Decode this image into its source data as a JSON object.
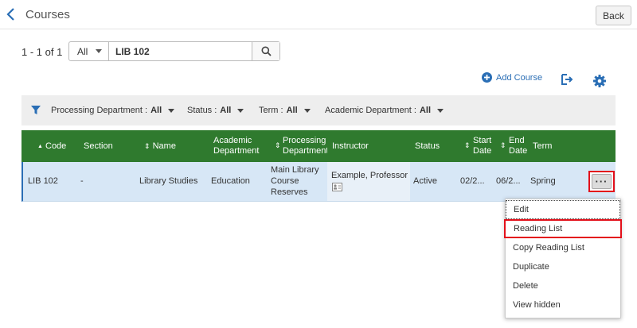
{
  "header": {
    "title": "Courses",
    "back_label": "Back"
  },
  "search": {
    "results_count": "1 - 1 of 1",
    "scope": "All",
    "query": "LIB 102"
  },
  "actions": {
    "add_course_label": "Add Course"
  },
  "filters": [
    {
      "label": "Processing Department :",
      "value": "All"
    },
    {
      "label": "Status :",
      "value": "All"
    },
    {
      "label": "Term :",
      "value": "All"
    },
    {
      "label": "Academic Department :",
      "value": "All"
    }
  ],
  "table": {
    "columns": [
      "Code",
      "Section",
      "Name",
      "Academic Department",
      "Processing Department",
      "Instructor",
      "Status",
      "Start Date",
      "End Date",
      "Term"
    ],
    "rows": [
      {
        "code": "LIB 102",
        "section": "-",
        "name": "Library Studies",
        "academic_department": "Education",
        "processing_department": "Main Library Course Reserves",
        "instructor": "Example, Professor",
        "status": "Active",
        "start_date": "02/2...",
        "end_date": "06/2...",
        "term": "Spring"
      }
    ]
  },
  "row_menu": [
    "Edit",
    "Reading List",
    "Copy Reading List",
    "Duplicate",
    "Delete",
    "View hidden"
  ],
  "colors": {
    "header_green": "#2f7a2e",
    "row_selected": "#d7e7f6",
    "highlight_red": "#e3101a",
    "link_blue": "#2a6eb5"
  },
  "icons": [
    "back-chevron-icon",
    "search-icon",
    "add-circle-icon",
    "export-icon",
    "gear-icon",
    "filter-icon",
    "contact-card-icon",
    "more-actions-icon"
  ]
}
